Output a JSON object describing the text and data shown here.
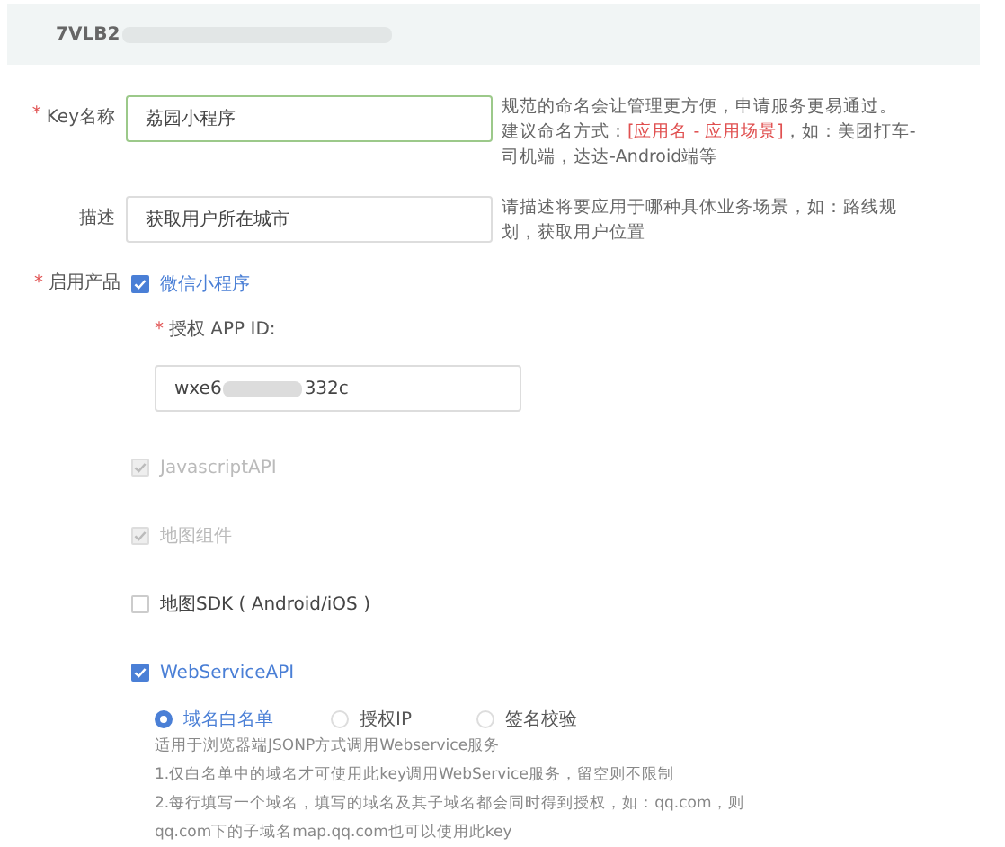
{
  "header": {
    "key_prefix": "7VLB2"
  },
  "fields": [
    {
      "required_mark": "*",
      "label": "Key名称",
      "focused": true,
      "value": "荔园小程序",
      "hint": [
        [
          {
            "text": "规范的命名会让管理更方便，申请服务更易通过。",
            "highlight": false
          }
        ],
        [
          {
            "text": "建议命名方式：",
            "highlight": false
          },
          {
            "text": "[应用名 - 应用场景]",
            "highlight": true
          },
          {
            "text": "，如：美团打车-司机端，达达-Android端等",
            "highlight": false
          }
        ]
      ]
    },
    {
      "label": "描述",
      "focused": false,
      "value": "获取用户所在城市",
      "hint": [
        [
          {
            "text": "请描述将要应用于哪种具体业务场景，如：路线规划，获取用户位置",
            "highlight": false
          }
        ]
      ]
    }
  ],
  "products": {
    "required_mark": "*",
    "label": "启用产品",
    "items": [
      {
        "kind": "appid",
        "label": "微信小程序",
        "checked": true,
        "disabled": false,
        "appid": {
          "required_mark": "*",
          "label": "授权 APP ID:",
          "value_start": "wxe6",
          "value_end": "332c"
        }
      },
      {
        "kind": "plain",
        "label": "JavascriptAPI",
        "checked": true,
        "disabled": true
      },
      {
        "kind": "plain",
        "label": "地图组件",
        "checked": true,
        "disabled": true
      },
      {
        "kind": "plain",
        "label": "地图SDK ( Android/iOS )",
        "checked": false,
        "disabled": false
      },
      {
        "kind": "webservice",
        "label": "WebServiceAPI",
        "checked": true,
        "disabled": false,
        "modes": [
          {
            "label": "域名白名单",
            "selected": true
          },
          {
            "label": "授权IP",
            "selected": false
          },
          {
            "label": "签名校验",
            "selected": false
          }
        ],
        "help": [
          "适用于浏览器端JSONP方式调用Webservice服务",
          "1.仅白名单中的域名才可使用此key调用WebService服务，留空则不限制",
          "2.每行填写一个域名，填写的域名及其子域名都会同时得到授权，如：qq.com，则",
          "qq.com下的子域名map.qq.com也可以使用此key"
        ]
      }
    ]
  }
}
